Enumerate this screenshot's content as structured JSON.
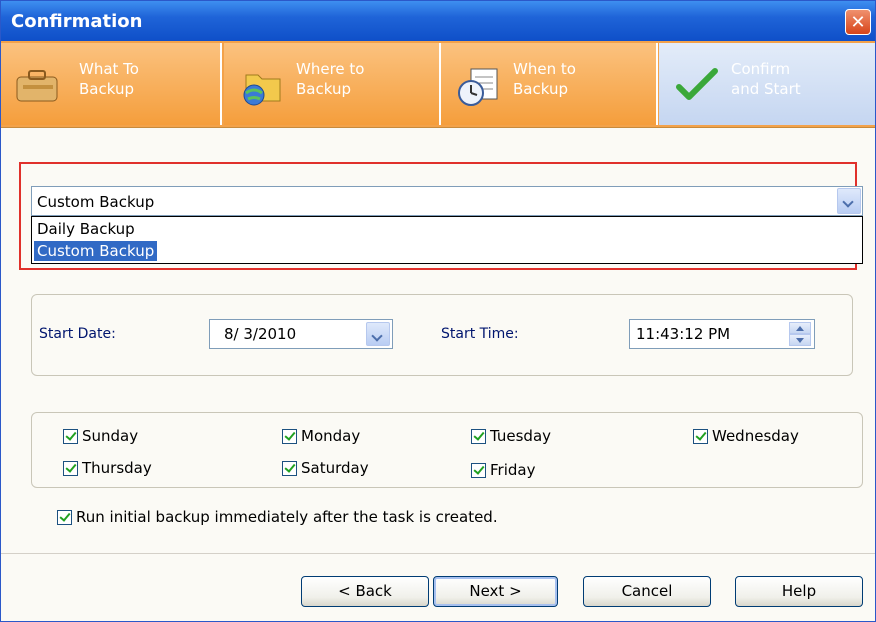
{
  "window": {
    "title": "Confirmation",
    "close_glyph": "✕"
  },
  "steps": [
    {
      "line1": "What To",
      "line2": "Backup",
      "icon": "briefcase-icon"
    },
    {
      "line1": "Where to",
      "line2": "Backup",
      "icon": "folder-globe-icon"
    },
    {
      "line1": "When to",
      "line2": "Backup",
      "icon": "clock-calendar-icon"
    },
    {
      "line1": "Confirm",
      "line2": "and Start",
      "icon": "checkmark-icon"
    }
  ],
  "schedule": {
    "selected": "Custom Backup",
    "options": [
      "Daily Backup",
      "Custom Backup"
    ],
    "highlighted_option": "Custom Backup"
  },
  "datetime": {
    "start_date_label": "Start Date:",
    "start_date_value": "8/ 3/2010",
    "start_time_label": "Start Time:",
    "start_time_value": "11:43:12 PM"
  },
  "days": [
    {
      "label": "Sunday",
      "checked": true
    },
    {
      "label": "Monday",
      "checked": true
    },
    {
      "label": "Tuesday",
      "checked": true
    },
    {
      "label": "Wednesday",
      "checked": true
    },
    {
      "label": "Thursday",
      "checked": true
    },
    {
      "label": "Saturday",
      "checked": true
    },
    {
      "label": "Friday",
      "checked": true
    }
  ],
  "run_initial": {
    "label": "Run initial backup immediately after the task is created.",
    "checked": true
  },
  "buttons": {
    "back": "< Back",
    "next": "Next >",
    "cancel": "Cancel",
    "help": "Help"
  },
  "colors": {
    "titlebar": "#1f64d8",
    "steps_bg": "#f59e3c",
    "active_step": "#c5d6f1",
    "highlight": "#316ac5",
    "red_frame": "#e0302b"
  }
}
